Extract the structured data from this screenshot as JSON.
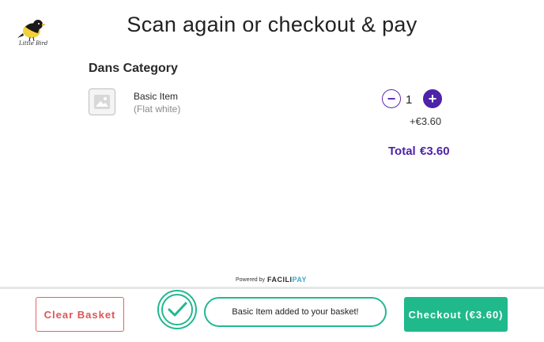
{
  "brand": {
    "logo_text": "Little Bird"
  },
  "page": {
    "title": "Scan again or checkout & pay"
  },
  "category": {
    "title": "Dans Category"
  },
  "item": {
    "name": "Basic Item",
    "variant": "(Flat white)",
    "quantity": "1",
    "price": "+€3.60",
    "minus_label": "−",
    "plus_label": "+"
  },
  "total": {
    "label": "Total",
    "value": "€3.60"
  },
  "footer": {
    "powered_by": "Powered by",
    "provider_main": "FACILI",
    "provider_accent": "PAY",
    "clear_label": "Clear Basket",
    "toast_message": "Basic Item added to your basket!",
    "checkout_label": "Checkout (€3.60)"
  },
  "colors": {
    "accent_purple": "#4e23a8",
    "success_green": "#20b98b",
    "danger_red": "#e05555",
    "bird_yellow": "#f2d13a"
  },
  "icons": [
    "bird-logo-icon",
    "image-placeholder-icon",
    "checkmark-circle-icon"
  ]
}
